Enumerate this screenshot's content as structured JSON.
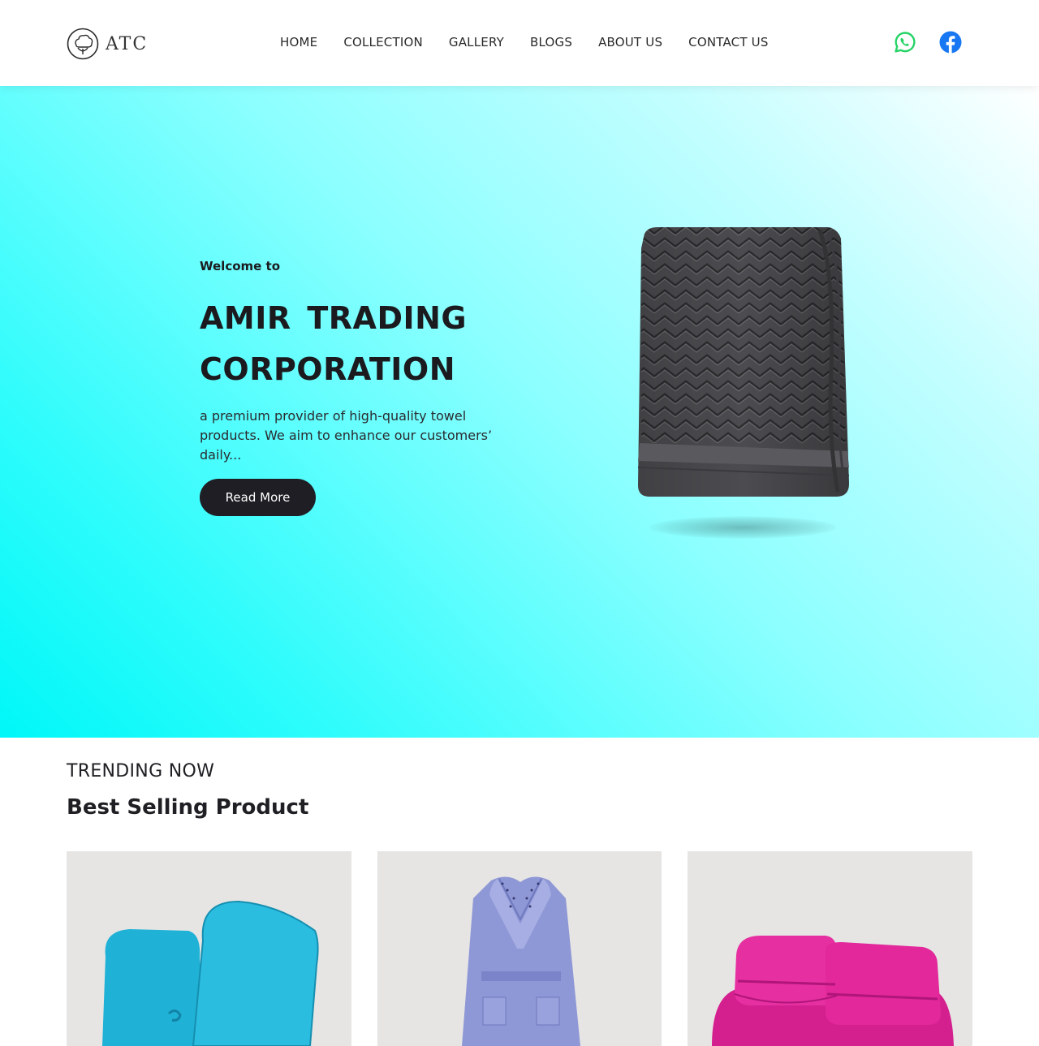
{
  "header": {
    "logo_text": "ATC",
    "nav": [
      "HOME",
      "COLLECTION",
      "GALLERY",
      "BLOGS",
      "ABOUT US",
      "CONTACT US"
    ],
    "social_icons": [
      "whatsapp-icon",
      "facebook-icon"
    ]
  },
  "hero": {
    "welcome": "Welcome to",
    "title": "AMIR TRADING CORPORATION",
    "description": "a premium provider of high-quality towel products. We aim to enhance our customers’ daily...",
    "cta_label": "Read More"
  },
  "trending": {
    "label": "TRENDING NOW",
    "title": "Best Selling Product"
  },
  "colors": {
    "accent_dark": "#1e1e24",
    "hero_cyan": "#00f7f8",
    "whatsapp_green": "#25d366",
    "facebook_blue": "#1877f2",
    "card_bg": "#e6e5e4"
  }
}
